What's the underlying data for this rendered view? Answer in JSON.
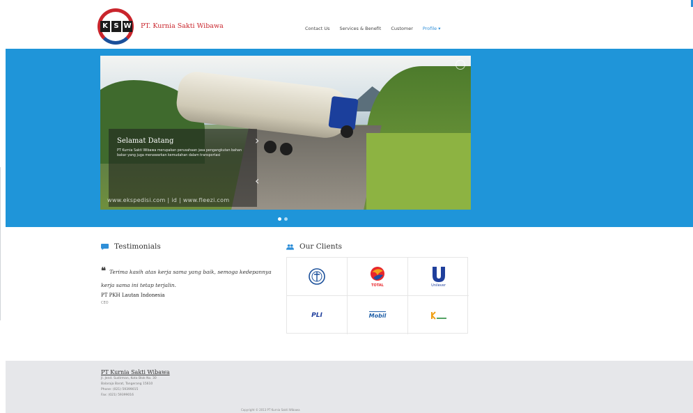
{
  "brand": {
    "logo_letters": [
      "K",
      "S",
      "W"
    ],
    "name": "PT. Kurnia Sakti Wibawa"
  },
  "nav": {
    "items": [
      "Contact Us",
      "Services & Benefit",
      "Customer",
      "Profile ▾"
    ]
  },
  "hero": {
    "caption_title": "Selamat Datang",
    "caption_text": "PT Kurnia Sakti Wibawa merupakan perusahaan jasa pengangkutan bahan bakar yang juga menawarkan kemudahan dalam transportasi",
    "prev_arrow": "‹",
    "next_arrow": "›",
    "watermark": "www.ekspedisi.com | id | www.fleezi.com",
    "dots": 2
  },
  "testimonials": {
    "title": "Testimonials",
    "quote_mark": "66",
    "quote": "Terima kasih atas kerja sama yang baik, semoga kedepannya kerja sama ini tetap terjalin.",
    "name": "PT PKH Lautan Indonesia",
    "role": "CEO"
  },
  "clients": {
    "title": "Our Clients",
    "logos": [
      "pertamina-logo",
      "total-logo",
      "unilever-logo",
      "pli-logo",
      "mobil-logo",
      "kideco-logo"
    ],
    "total_label": "TOTAL",
    "unilever_label": "Unilever",
    "pli_label": "PLI",
    "mobil_label": "Mobil"
  },
  "footer": {
    "title": "PT Kurnia Sakti Wibawa",
    "address1": "Jl. Jend. Sudirman, Kota Blok No. 30",
    "address2": "Balaraja Barat, Tangerang 15610",
    "phone": "Phone: (021) 59399015",
    "fax": "Fax: (021) 59399016",
    "copyright": "Copyright © 2013 PT Kurnia Sakti Wibawa"
  },
  "colors": {
    "accent_blue": "#1f95d9",
    "brand_red": "#c9252c",
    "footer_bg": "#e6e7ea"
  }
}
